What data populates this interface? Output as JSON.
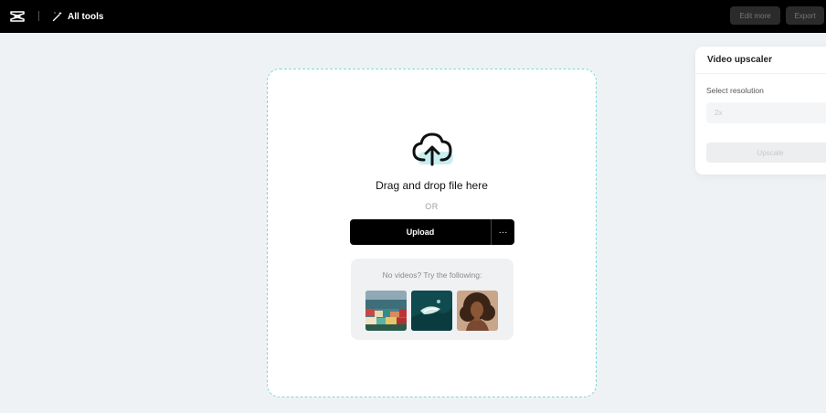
{
  "header": {
    "all_tools_label": "All tools",
    "edit_more_label": "Edit more",
    "export_label": "Export"
  },
  "dropzone": {
    "drag_text": "Drag and drop file here",
    "or_text": "OR",
    "upload_label": "Upload",
    "more_label": "···",
    "samples_label": "No videos? Try the following:"
  },
  "panel": {
    "title": "Video upscaler",
    "resolution_label": "Select resolution",
    "resolution_value": "2x",
    "upscale_label": "Upscale"
  },
  "colors": {
    "topbar": "#000000",
    "background": "#eff2f4",
    "dashed_border": "#7dd8d8",
    "cloud_accent": "#c8eef0"
  },
  "icons": {
    "logo": "capcut-logo-icon",
    "tools": "magic-wand-icon",
    "upload": "cloud-upload-icon",
    "more": "more-dots-icon"
  }
}
